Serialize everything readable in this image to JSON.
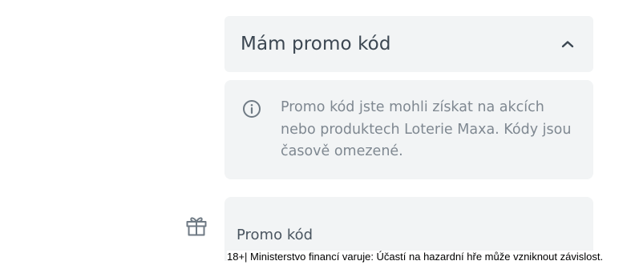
{
  "promo_section": {
    "title": "Mám promo kód",
    "toggle_icon": "chevron-up-icon",
    "expanded": true
  },
  "info": {
    "icon": "info-icon",
    "text": "Promo kód jste mohli získat na akcích nebo produktech Loterie Maxa. Kódy jsou časově omezené."
  },
  "promo_input": {
    "icon": "gift-icon",
    "value": "",
    "placeholder": "Promo kód"
  },
  "disclaimer": {
    "text": "18+| Ministerstvo financí varuje: Účastí na hazardní hře může vzniknout závislost."
  },
  "colors": {
    "panel_bg": "#f2f4f5",
    "title_text": "#3b4651",
    "muted_text": "#7f8891",
    "icon_gray": "#6f7a84"
  }
}
